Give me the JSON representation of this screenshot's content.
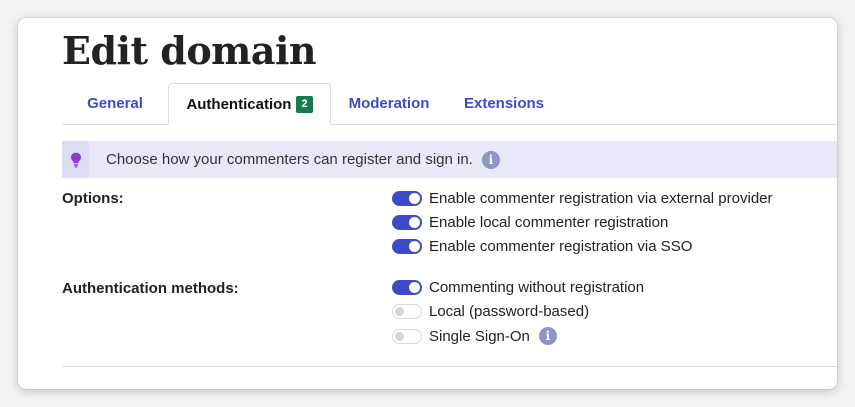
{
  "page": {
    "title": "Edit domain"
  },
  "tabs": [
    {
      "label": "General",
      "active": false
    },
    {
      "label": "Authentication",
      "active": true,
      "badge": "2"
    },
    {
      "label": "Moderation",
      "active": false
    },
    {
      "label": "Extensions",
      "active": false
    }
  ],
  "info_banner": {
    "text": "Choose how your commenters can register and sign in.",
    "icon": "lightbulb-icon"
  },
  "options": {
    "label": "Options:",
    "items": [
      {
        "label": "Enable commenter registration via external provider",
        "enabled": true
      },
      {
        "label": "Enable local commenter registration",
        "enabled": true
      },
      {
        "label": "Enable commenter registration via SSO",
        "enabled": true
      }
    ]
  },
  "auth_methods": {
    "label": "Authentication methods:",
    "items": [
      {
        "label": "Commenting without registration",
        "enabled": true
      },
      {
        "label": "Local (password-based)",
        "enabled": false
      },
      {
        "label": "Single Sign-On",
        "enabled": false,
        "info_icon": "info-icon"
      }
    ]
  },
  "colors": {
    "accent": "#3b4cc6",
    "badge": "#137a52",
    "banner_bg": "#e8e8f8",
    "bulb": "#8a3ccf",
    "info_icon": "#8f95c9"
  }
}
